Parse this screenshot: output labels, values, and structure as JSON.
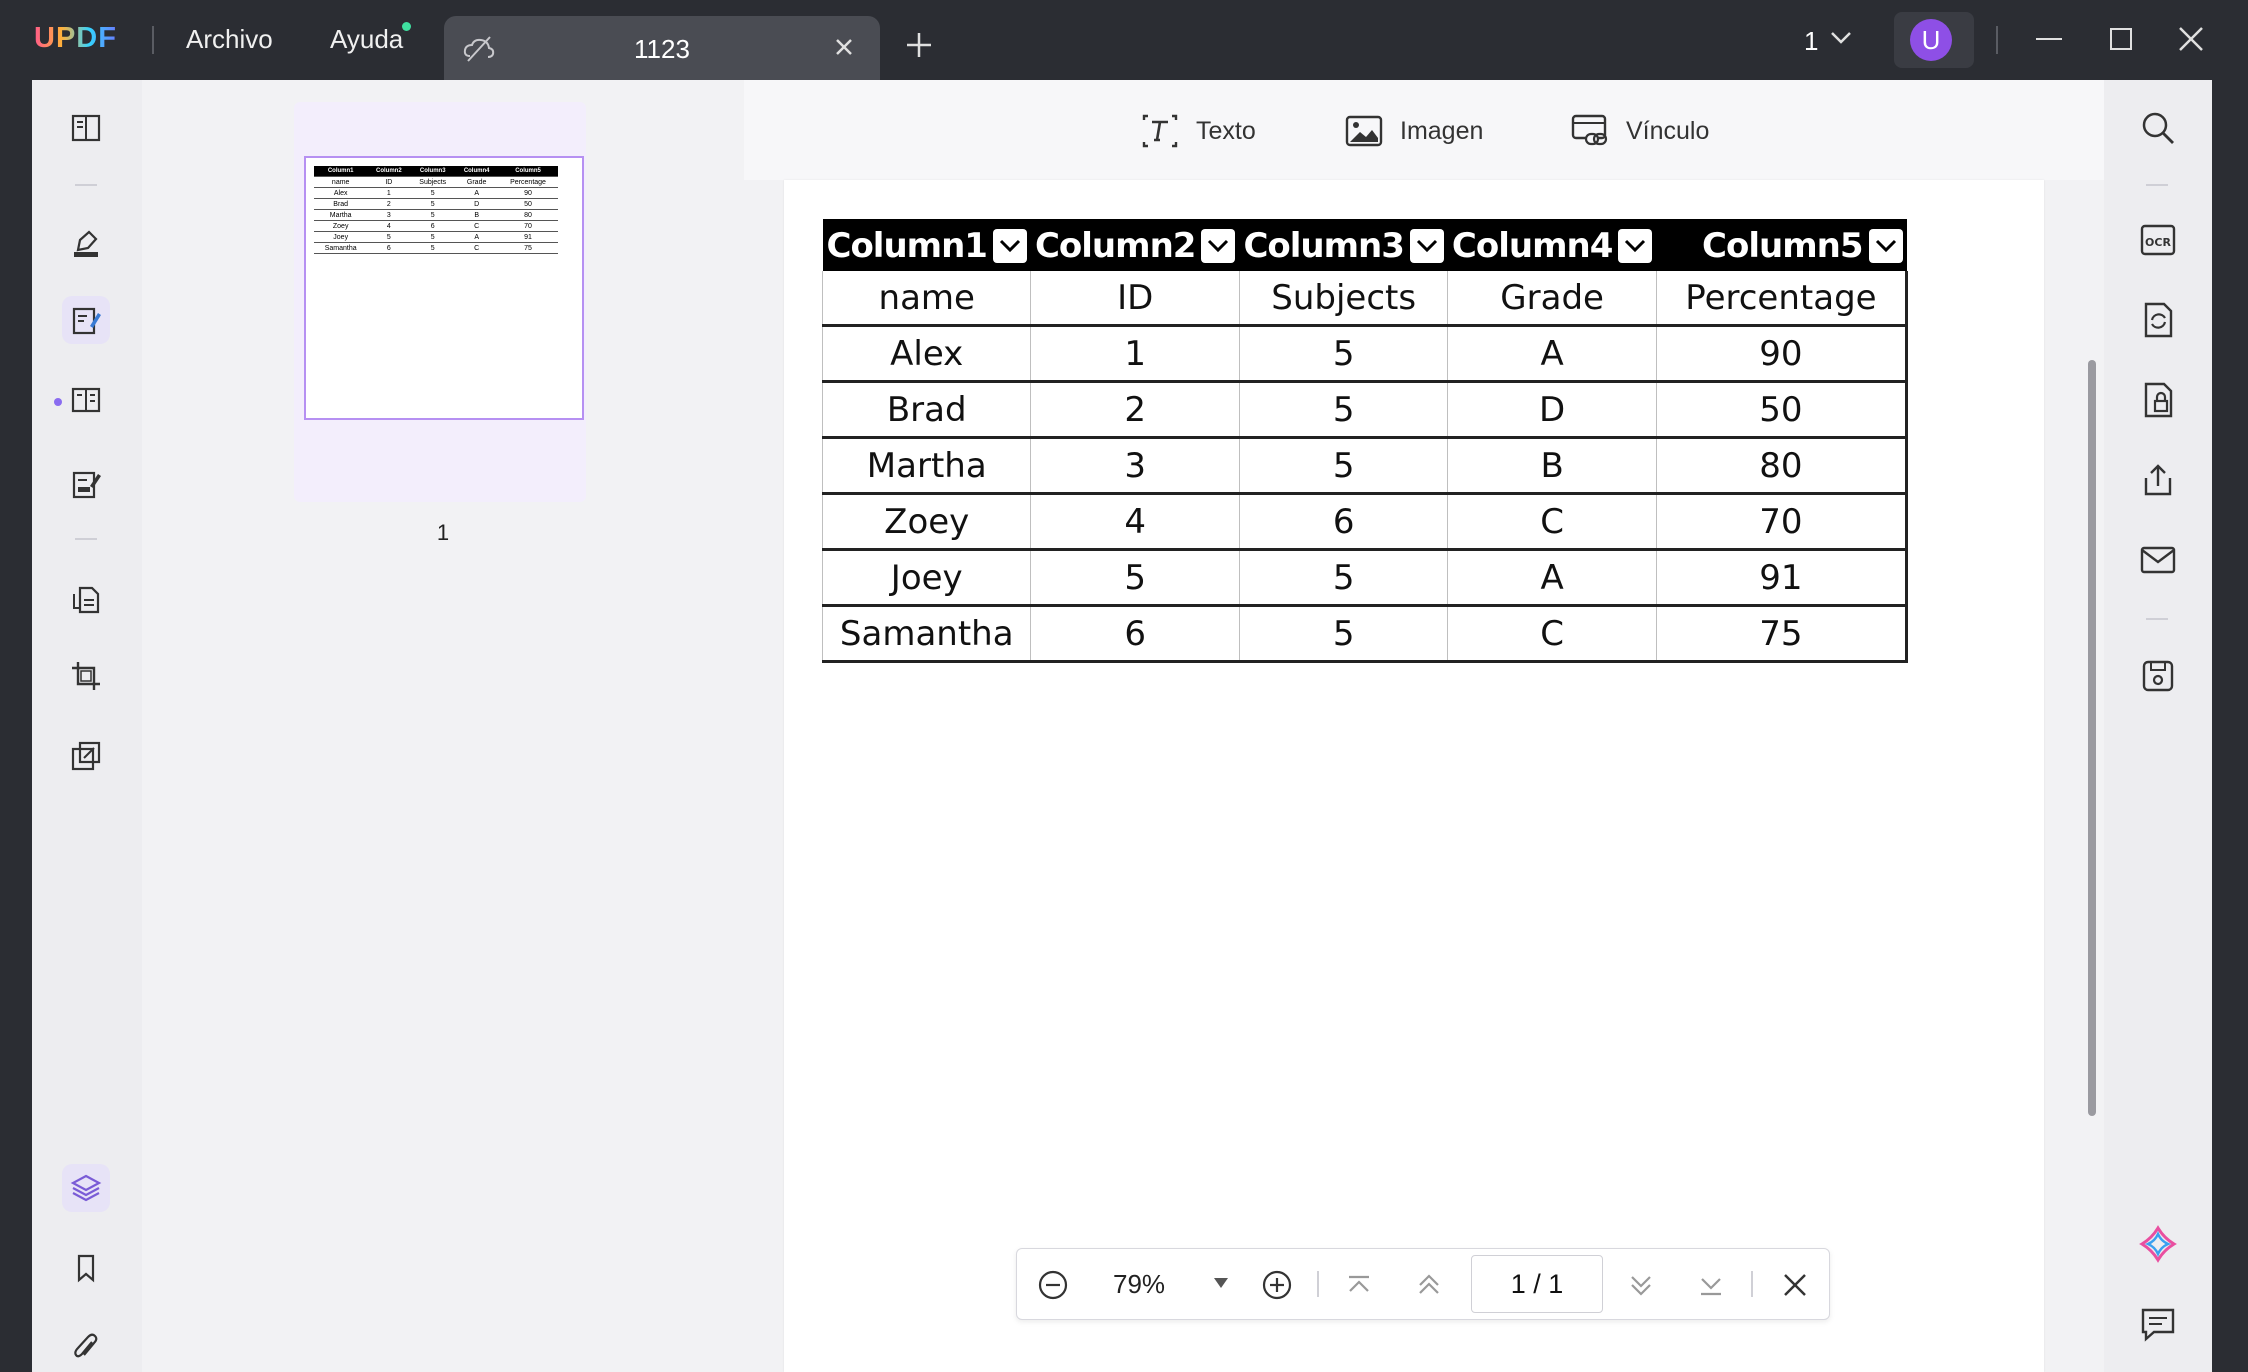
{
  "app": {
    "logo": "UPDF",
    "menu": [
      "Archivo",
      "Ayuda"
    ],
    "tab_title": "1123",
    "page_selector": "1",
    "avatar_initial": "U"
  },
  "edit_toolbar": {
    "text_label": "Texto",
    "image_label": "Imagen",
    "link_label": "Vínculo"
  },
  "thumbnail": {
    "page_number": "1"
  },
  "table": {
    "headers": [
      "Column1",
      "Column2",
      "Column3",
      "Column4",
      "Column5"
    ],
    "rows": [
      [
        "name",
        "ID",
        "Subjects",
        "Grade",
        "Percentage"
      ],
      [
        "Alex",
        "1",
        "5",
        "A",
        "90"
      ],
      [
        "Brad",
        "2",
        "5",
        "D",
        "50"
      ],
      [
        "Martha",
        "3",
        "5",
        "B",
        "80"
      ],
      [
        "Zoey",
        "4",
        "6",
        "C",
        "70"
      ],
      [
        "Joey",
        "5",
        "5",
        "A",
        "91"
      ],
      [
        "Samantha",
        "6",
        "5",
        "C",
        "75"
      ]
    ]
  },
  "nav": {
    "zoom": "79%",
    "page_indicator": "1 / 1"
  },
  "colors": {
    "titlebar": "#2b2d33",
    "accent": "#8a6cf0",
    "avatar": "#8e4fe6"
  }
}
